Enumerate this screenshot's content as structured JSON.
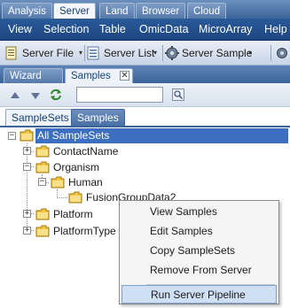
{
  "top_tabs": [
    "Analysis",
    "Server",
    "Land",
    "Browser",
    "Cloud"
  ],
  "active_top_tab": "Server",
  "menu": [
    "View",
    "Selection",
    "Table",
    "OmicData",
    "MicroArray",
    "Help"
  ],
  "toolbar": {
    "server_file": "Server File",
    "server_list": "Server List",
    "server_sample": "Server Sample"
  },
  "pane_tabs": {
    "wizard": "Wizard",
    "samples": "Samples"
  },
  "search": {
    "value": ""
  },
  "sub_tabs": {
    "samplesets": "SampleSets",
    "samples": "Samples"
  },
  "tree": {
    "root": "All SampleSets",
    "contact": "ContactName",
    "organism": "Organism",
    "human": "Human",
    "fusion": "FusionGroupData2",
    "platform": "Platform",
    "platformtype": "PlatformType"
  },
  "context_menu": {
    "view": "View Samples",
    "edit": "Edit Samples",
    "copy": "Copy SampleSets",
    "remove": "Remove From Server",
    "run": "Run Server Pipeline"
  },
  "colors": {
    "selection": "#3d6fc0",
    "menubar": "#1c4680",
    "highlight": "#cfe0f6"
  }
}
